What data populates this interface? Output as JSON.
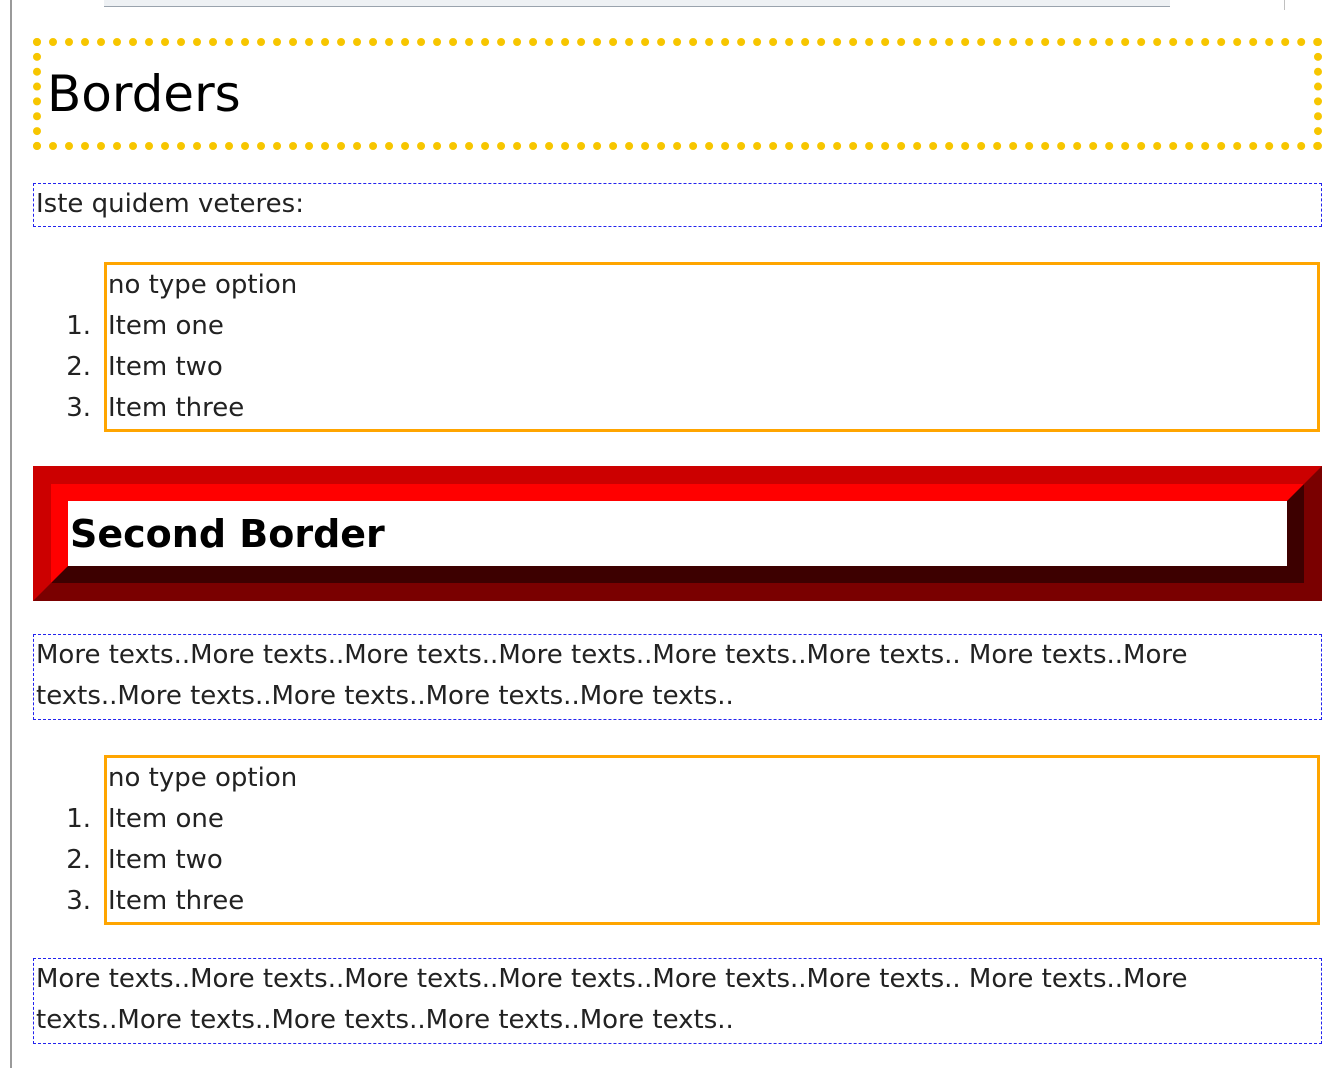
{
  "heading": "Borders",
  "intro": "Iste quidem veteres:",
  "lists": [
    {
      "caption": "no type option",
      "items": [
        {
          "num": "1.",
          "text": "Item one"
        },
        {
          "num": "2.",
          "text": "Item two"
        },
        {
          "num": "3.",
          "text": "Item three"
        }
      ]
    },
    {
      "caption": "no type option",
      "items": [
        {
          "num": "1.",
          "text": "Item one"
        },
        {
          "num": "2.",
          "text": "Item two"
        },
        {
          "num": "3.",
          "text": "Item three"
        }
      ]
    }
  ],
  "second_heading": "Second Border",
  "paragraphs": [
    {
      "line1": "More texts..More texts..More texts..More texts..More texts..More texts.. More texts..More",
      "line2": "texts..More texts..More texts..More texts..More texts.."
    },
    {
      "line1": "More texts..More texts..More texts..More texts..More texts..More texts.. More texts..More",
      "line2": "texts..More texts..More texts..More texts..More texts.."
    }
  ],
  "colors": {
    "dotted_border": "#f7c600",
    "dashed_border": "#2222ee",
    "list_border": "#ffa500",
    "ridge_light": "#ff0000",
    "ridge_dark": "#3d0000"
  }
}
